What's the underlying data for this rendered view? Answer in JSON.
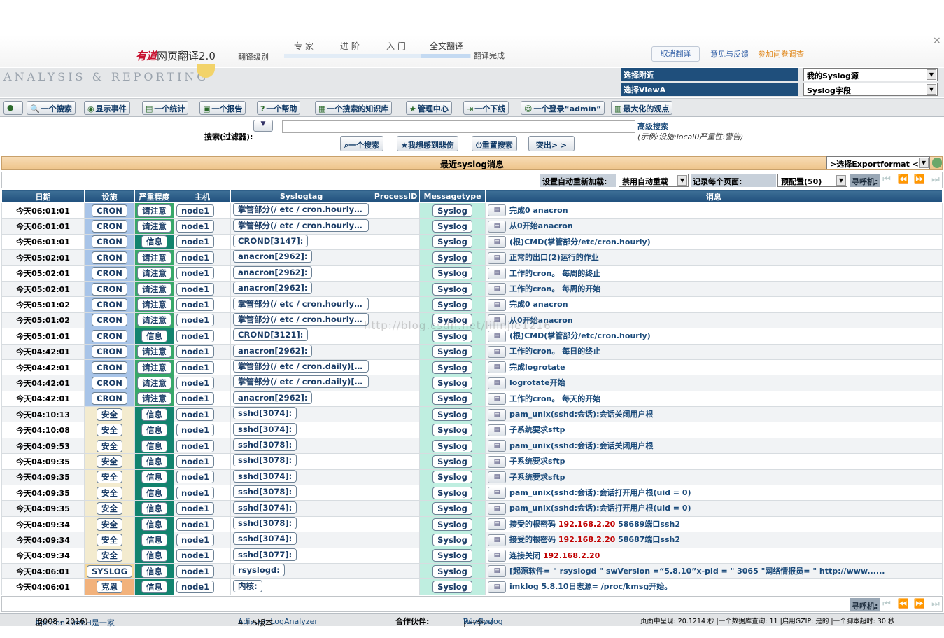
{
  "youdao": {
    "logo_mark": "有道",
    "logo_text": "网页翻译2.0",
    "level_label": "翻译级别",
    "levels": [
      "专 家",
      "进 阶",
      "入 门",
      "全文翻译"
    ],
    "done_label": "翻译完成",
    "cancel_label": "取消翻译",
    "feedback_label": "意见与反馈",
    "survey_label": "参加问卷调查",
    "close_glyph": "×"
  },
  "header": {
    "brand": "ANALYSIS & REPORTING",
    "select_source_label": "选择附近",
    "select_source_value": "我的Syslog源",
    "select_view_label": "选择ViewA",
    "select_view_value": "Syslog字段"
  },
  "toolbar": [
    "",
    "一个搜索",
    "显示事件",
    "一个统计",
    "一个报告",
    "一个帮助",
    "一个搜索的知识库",
    "管理中心",
    "一个下线",
    "一个登录“admin”",
    "最大化的观点"
  ],
  "search": {
    "label": "搜索(过滤器):",
    "value": "",
    "advanced_label": "高级搜索",
    "example": "(示例:设施:local0严重性:警告)",
    "buttons": [
      "一个搜索",
      "我想感到悲伤",
      "重置搜索",
      "突出> >"
    ]
  },
  "panel": {
    "title": "最近syslog消息",
    "export_value": ">选择Exportformat <"
  },
  "controls": {
    "autoreload_label": "设置自动重新加载:",
    "autoreload_value": "禁用自动重载",
    "perpage_label": "记录每个页面:",
    "perpage_value": "预配置(50)",
    "pager_label": "寻呼机:"
  },
  "colors": {
    "header_blue": "#1f4f7c",
    "title_orange": "#eec48a",
    "fac_cron": "#a8c4e8",
    "fac_security": "#f3ebcf",
    "fac_syslog": "#f5d89a",
    "fac_kern": "#f2b27c",
    "sev_notice": "#38a869",
    "sev_info": "#12836e",
    "msgtype": "#bfeee0",
    "ip_red": "#c00000"
  },
  "columns": [
    "日期",
    "设施",
    "严重程度",
    "主机",
    "Syslogtag",
    "ProcessID",
    "Messagetype",
    "消息"
  ],
  "rows": [
    {
      "date": "今天06:01:01",
      "facility": "CRON",
      "fac_color": "#a8c4e8",
      "severity": "请注意",
      "sev_color": "#38a869",
      "host": "node1",
      "tag": "掌管部分(/ etc / cron.hourly)[31…",
      "pid": "",
      "mtype": "Syslog",
      "msg": "完成0 anacron",
      "ip": "",
      "msg_tail": ""
    },
    {
      "date": "今天06:01:01",
      "facility": "CRON",
      "fac_color": "#a8c4e8",
      "severity": "请注意",
      "sev_color": "#38a869",
      "host": "node1",
      "tag": "掌管部分(/ etc / cron.hourly)[31…",
      "pid": "",
      "mtype": "Syslog",
      "msg": "从0开始anacron",
      "ip": "",
      "msg_tail": ""
    },
    {
      "date": "今天06:01:01",
      "facility": "CRON",
      "fac_color": "#a8c4e8",
      "severity": "信息",
      "sev_color": "#12836e",
      "host": "node1",
      "tag": "CROND[3147]:",
      "pid": "",
      "mtype": "Syslog",
      "msg": "(根)CMD(掌管部分/etc/cron.hourly)",
      "ip": "",
      "msg_tail": ""
    },
    {
      "date": "今天05:02:01",
      "facility": "CRON",
      "fac_color": "#a8c4e8",
      "severity": "请注意",
      "sev_color": "#38a869",
      "host": "node1",
      "tag": "anacron[2962]:",
      "pid": "",
      "mtype": "Syslog",
      "msg": "正常的出口(2)运行的作业",
      "ip": "",
      "msg_tail": ""
    },
    {
      "date": "今天05:02:01",
      "facility": "CRON",
      "fac_color": "#a8c4e8",
      "severity": "请注意",
      "sev_color": "#38a869",
      "host": "node1",
      "tag": "anacron[2962]:",
      "pid": "",
      "mtype": "Syslog",
      "msg": "工作的cron。 每周的终止",
      "ip": "",
      "msg_tail": ""
    },
    {
      "date": "今天05:02:01",
      "facility": "CRON",
      "fac_color": "#a8c4e8",
      "severity": "请注意",
      "sev_color": "#38a869",
      "host": "node1",
      "tag": "anacron[2962]:",
      "pid": "",
      "mtype": "Syslog",
      "msg": "工作的cron。 每周的开始",
      "ip": "",
      "msg_tail": ""
    },
    {
      "date": "今天05:01:02",
      "facility": "CRON",
      "fac_color": "#a8c4e8",
      "severity": "请注意",
      "sev_color": "#38a869",
      "host": "node1",
      "tag": "掌管部分(/ etc / cron.hourly)[31…",
      "pid": "",
      "mtype": "Syslog",
      "msg": "完成0 anacron",
      "ip": "",
      "msg_tail": ""
    },
    {
      "date": "今天05:01:02",
      "facility": "CRON",
      "fac_color": "#a8c4e8",
      "severity": "请注意",
      "sev_color": "#38a869",
      "host": "node1",
      "tag": "掌管部分(/ etc / cron.hourly)[31…",
      "pid": "",
      "mtype": "Syslog",
      "msg": "从0开始anacron",
      "ip": "",
      "msg_tail": ""
    },
    {
      "date": "今天05:01:01",
      "facility": "CRON",
      "fac_color": "#a8c4e8",
      "severity": "信息",
      "sev_color": "#12836e",
      "host": "node1",
      "tag": "CROND[3121]:",
      "pid": "",
      "mtype": "Syslog",
      "msg": "(根)CMD(掌管部分/etc/cron.hourly)",
      "ip": "",
      "msg_tail": ""
    },
    {
      "date": "今天04:42:01",
      "facility": "CRON",
      "fac_color": "#a8c4e8",
      "severity": "请注意",
      "sev_color": "#38a869",
      "host": "node1",
      "tag": "anacron[2962]:",
      "pid": "",
      "mtype": "Syslog",
      "msg": "工作的cron。 每日的终止",
      "ip": "",
      "msg_tail": ""
    },
    {
      "date": "今天04:42:01",
      "facility": "CRON",
      "fac_color": "#a8c4e8",
      "severity": "请注意",
      "sev_color": "#38a869",
      "host": "node1",
      "tag": "掌管部分(/ etc / cron.daily)[311…",
      "pid": "",
      "mtype": "Syslog",
      "msg": "完成logrotate",
      "ip": "",
      "msg_tail": ""
    },
    {
      "date": "今天04:42:01",
      "facility": "CRON",
      "fac_color": "#a8c4e8",
      "severity": "请注意",
      "sev_color": "#38a869",
      "host": "node1",
      "tag": "掌管部分(/ etc / cron.daily)[311…",
      "pid": "",
      "mtype": "Syslog",
      "msg": "logrotate开始",
      "ip": "",
      "msg_tail": ""
    },
    {
      "date": "今天04:42:01",
      "facility": "CRON",
      "fac_color": "#a8c4e8",
      "severity": "请注意",
      "sev_color": "#38a869",
      "host": "node1",
      "tag": "anacron[2962]:",
      "pid": "",
      "mtype": "Syslog",
      "msg": "工作的cron。 每天的开始",
      "ip": "",
      "msg_tail": ""
    },
    {
      "date": "今天04:10:13",
      "facility": "安全",
      "fac_color": "#f3ebcf",
      "severity": "信息",
      "sev_color": "#12836e",
      "host": "node1",
      "tag": "sshd[3074]:",
      "pid": "",
      "mtype": "Syslog",
      "msg": "pam_unix(sshd:会话):会话关闭用户根",
      "ip": "",
      "msg_tail": ""
    },
    {
      "date": "今天04:10:08",
      "facility": "安全",
      "fac_color": "#f3ebcf",
      "severity": "信息",
      "sev_color": "#12836e",
      "host": "node1",
      "tag": "sshd[3074]:",
      "pid": "",
      "mtype": "Syslog",
      "msg": "子系统要求sftp",
      "ip": "",
      "msg_tail": ""
    },
    {
      "date": "今天04:09:53",
      "facility": "安全",
      "fac_color": "#f3ebcf",
      "severity": "信息",
      "sev_color": "#12836e",
      "host": "node1",
      "tag": "sshd[3078]:",
      "pid": "",
      "mtype": "Syslog",
      "msg": "pam_unix(sshd:会话):会话关闭用户根",
      "ip": "",
      "msg_tail": ""
    },
    {
      "date": "今天04:09:35",
      "facility": "安全",
      "fac_color": "#f3ebcf",
      "severity": "信息",
      "sev_color": "#12836e",
      "host": "node1",
      "tag": "sshd[3078]:",
      "pid": "",
      "mtype": "Syslog",
      "msg": "子系统要求sftp",
      "ip": "",
      "msg_tail": ""
    },
    {
      "date": "今天04:09:35",
      "facility": "安全",
      "fac_color": "#f3ebcf",
      "severity": "信息",
      "sev_color": "#12836e",
      "host": "node1",
      "tag": "sshd[3074]:",
      "pid": "",
      "mtype": "Syslog",
      "msg": "子系统要求sftp",
      "ip": "",
      "msg_tail": ""
    },
    {
      "date": "今天04:09:35",
      "facility": "安全",
      "fac_color": "#f3ebcf",
      "severity": "信息",
      "sev_color": "#12836e",
      "host": "node1",
      "tag": "sshd[3078]:",
      "pid": "",
      "mtype": "Syslog",
      "msg": "pam_unix(sshd:会话):会话打开用户根(uid = 0)",
      "ip": "",
      "msg_tail": ""
    },
    {
      "date": "今天04:09:35",
      "facility": "安全",
      "fac_color": "#f3ebcf",
      "severity": "信息",
      "sev_color": "#12836e",
      "host": "node1",
      "tag": "sshd[3074]:",
      "pid": "",
      "mtype": "Syslog",
      "msg": "pam_unix(sshd:会话):会话打开用户根(uid = 0)",
      "ip": "",
      "msg_tail": ""
    },
    {
      "date": "今天04:09:34",
      "facility": "安全",
      "fac_color": "#f3ebcf",
      "severity": "信息",
      "sev_color": "#12836e",
      "host": "node1",
      "tag": "sshd[3078]:",
      "pid": "",
      "mtype": "Syslog",
      "msg": "接受的根密码 ",
      "ip": "192.168.2.20",
      "msg_tail": " 58689端口ssh2"
    },
    {
      "date": "今天04:09:34",
      "facility": "安全",
      "fac_color": "#f3ebcf",
      "severity": "信息",
      "sev_color": "#12836e",
      "host": "node1",
      "tag": "sshd[3074]:",
      "pid": "",
      "mtype": "Syslog",
      "msg": "接受的根密码 ",
      "ip": "192.168.2.20",
      "msg_tail": " 58687端口ssh2"
    },
    {
      "date": "今天04:09:34",
      "facility": "安全",
      "fac_color": "#f3ebcf",
      "severity": "信息",
      "sev_color": "#12836e",
      "host": "node1",
      "tag": "sshd[3077]:",
      "pid": "",
      "mtype": "Syslog",
      "msg": "连接关闭 ",
      "ip": "192.168.2.20",
      "msg_tail": ""
    },
    {
      "date": "今天04:06:01",
      "facility": "SYSLOG",
      "fac_color": "#f5d89a",
      "severity": "信息",
      "sev_color": "#12836e",
      "host": "node1",
      "tag": "rsyslogd:",
      "pid": "",
      "mtype": "Syslog",
      "msg": "[起源软件= \" rsyslogd \" swVersion =“5.8.10”x-pid = \" 3065 \"网络情报员= \" http://www......",
      "ip": "",
      "msg_tail": ""
    },
    {
      "date": "今天04:06:01",
      "facility": "克恩",
      "fac_color": "#f2b27c",
      "severity": "信息",
      "sev_color": "#12836e",
      "host": "node1",
      "tag": "内核:",
      "pid": "",
      "mtype": "Syslog",
      "msg": "imklog 5.8.10日志源= /proc/kmsg开始。",
      "ip": "",
      "msg_tail": ""
    }
  ],
  "watermark": "http://blog.csdn.net/lilinjie1216",
  "footer": {
    "by_prefix": "由",
    "by_link": "Adiscon GmbH是一家",
    "by_years": "(2008 - 2016)",
    "product": "Adiscon LogAnalyzer",
    "version": "4.1.5版本",
    "partners_label": "合作伙伴:",
    "partner1": "Rsyslog",
    "partner_sep": "| 一个",
    "partner2": "WinSyslog",
    "stats": "页面中呈现: 20.1214 秒 |一个数据库查询: 11 |启用GZIP: 是的 |一个脚本超时: 30 秒"
  }
}
